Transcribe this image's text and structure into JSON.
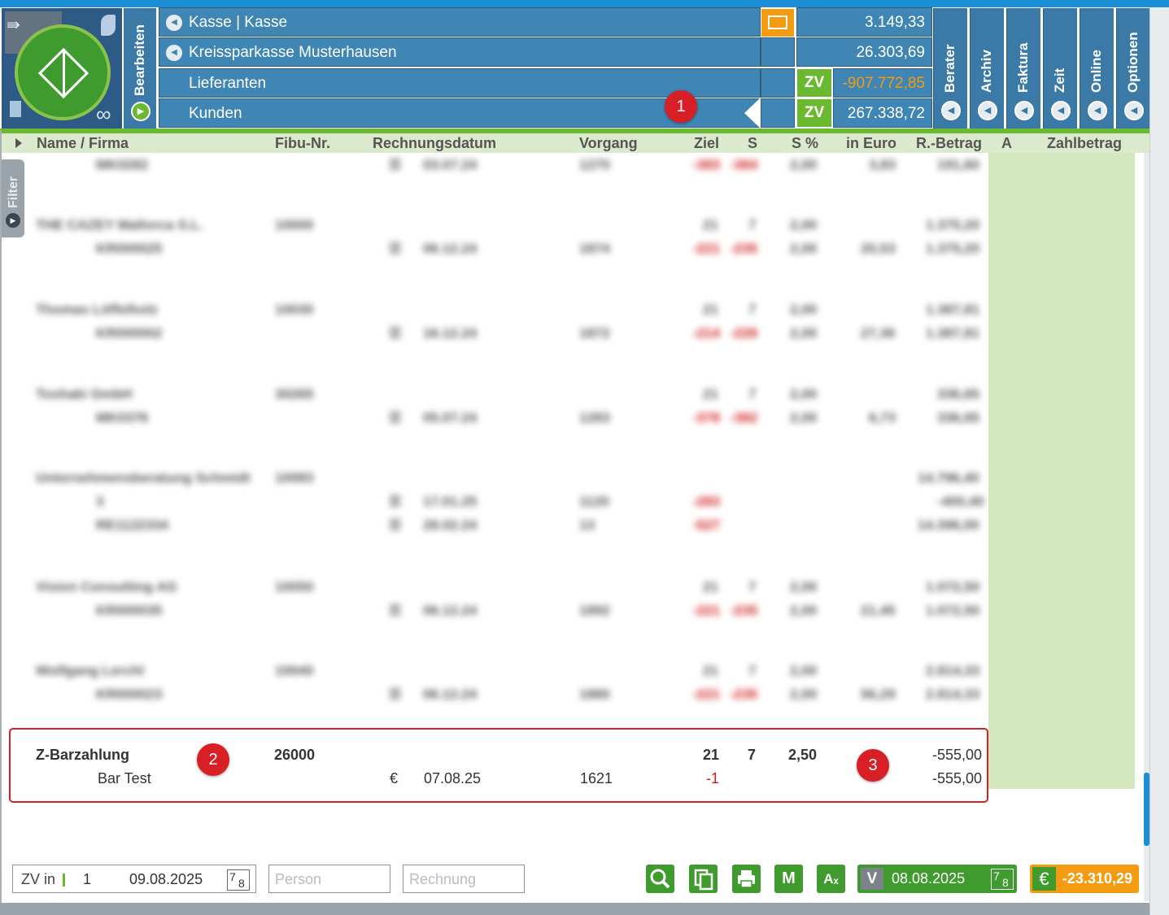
{
  "sidebar": {
    "bearbeiten": "Bearbeiten",
    "filter": "Filter"
  },
  "accounts": [
    {
      "label": "Kasse | Kasse",
      "value": "3.149,33",
      "zv": ""
    },
    {
      "label": "Kreissparkasse Musterhausen",
      "value": "26.303,69",
      "zv": ""
    },
    {
      "label": "Lieferanten",
      "value": "-907.772,85",
      "zv": "ZV"
    },
    {
      "label": "Kunden",
      "value": "267.338,72",
      "zv": "ZV"
    }
  ],
  "right_tabs": [
    "Berater",
    "Archiv",
    "Faktura",
    "Zeit",
    "Online",
    "Optionen"
  ],
  "table": {
    "headers": [
      "Name / Firma",
      "Fibu-Nr.",
      "Rechnungsdatum",
      "Vorgang",
      "Ziel",
      "S",
      "S %",
      "in Euro",
      "R.-Betrag",
      "A",
      "Zahlbetrag"
    ]
  },
  "blurred": {
    "row0": {
      "sub": "MK0282",
      "date": "03.07.24",
      "vorgang": "1270",
      "ziel": "-383",
      "s": "-384",
      "sp": "2,00",
      "eur": "3,83",
      "betrag": "191,60"
    },
    "row1": {
      "name": "THE CAZEY Mallorca S.L.",
      "fibu": "10000",
      "ziel": "21",
      "s": "7",
      "sp": "2,00",
      "betrag": "1.375,20",
      "sub": "KR000025",
      "date": "06.12.24",
      "vorgang": "1874",
      "zielr": "-221",
      "sr": "-235",
      "sp2": "2,00",
      "eur": "20,53",
      "betrag2": "1.375,20"
    },
    "row2": {
      "name": "Thomas Löffelholz",
      "fibu": "10030",
      "ziel": "21",
      "s": "7",
      "sp": "2,00",
      "betrag": "1.387,81",
      "sub": "KR000002",
      "date": "16.12.24",
      "vorgang": "1872",
      "zielr": "-214",
      "sr": "-228",
      "sp2": "2,00",
      "eur": "27,36",
      "betrag2": "1.387,81"
    },
    "row3": {
      "name": "Toshaki GmbH",
      "fibu": "30265",
      "ziel": "21",
      "s": "7",
      "sp": "2,00",
      "betrag": "336,65",
      "sub": "MK0376",
      "date": "05.07.24",
      "vorgang": "1283",
      "zielr": "-378",
      "sr": "-382",
      "sp2": "2,00",
      "eur": "6,73",
      "betrag2": "336,65"
    },
    "row4": {
      "name": "Unternehmensberatung Schmidt",
      "fibu": "10083",
      "betrag": "14.796,40",
      "sub1": "3",
      "date1": "17.01.25",
      "vorgang1": "1120",
      "ziel1": "-283",
      "betrag1": "-400,40",
      "sub2": "RE1122334",
      "date2": "28.02.24",
      "vorgang2": "13",
      "ziel2": "-527",
      "betrag2": "14.396,00"
    },
    "row5": {
      "name": "Vision Consulting AG",
      "fibu": "10050",
      "ziel": "21",
      "s": "7",
      "sp": "2,00",
      "betrag": "1.072,50",
      "sub": "KR000035",
      "date": "06.12.24",
      "vorgang": "1892",
      "zielr": "-221",
      "sr": "-235",
      "sp2": "2,00",
      "eur": "21,45",
      "betrag2": "1.072,50"
    },
    "row6": {
      "name": "Wolfgang Lerchl",
      "fibu": "10040",
      "ziel": "21",
      "s": "7",
      "sp": "2,00",
      "betrag": "2.814,33",
      "sub": "KR000023",
      "date": "06.12.24",
      "vorgang": "1880",
      "zielr": "-221",
      "sr": "-235",
      "sp2": "2,00",
      "eur": "56,29",
      "betrag2": "2.814,33"
    }
  },
  "highlight": {
    "name": "Z-Barzahlung",
    "fibu": "26000",
    "ziel": "21",
    "s": "7",
    "sp": "2,50",
    "betrag": "-555,00",
    "sub": "Bar Test",
    "currency": "€",
    "date": "07.08.25",
    "vorgang": "1621",
    "zielr": "-1",
    "betrag2": "-555,00"
  },
  "badges": [
    "1",
    "2",
    "3"
  ],
  "footer": {
    "zv_label": "ZV in",
    "zv_num": "1",
    "zv_date": "09.08.2025",
    "person_placeholder": "Person",
    "rechnung_placeholder": "Rechnung",
    "btn_m": "M",
    "btn_a": "Aₓ",
    "v_label": "V",
    "v_date": "08.08.2025",
    "euro": "€",
    "euro_value": "-23.310,29",
    "cal_a": "7",
    "cal_b": "8"
  },
  "colors": {
    "header_blue": "#3f86b4",
    "green": "#6bb931",
    "orange": "#f39c12",
    "red": "#d01a1a"
  }
}
